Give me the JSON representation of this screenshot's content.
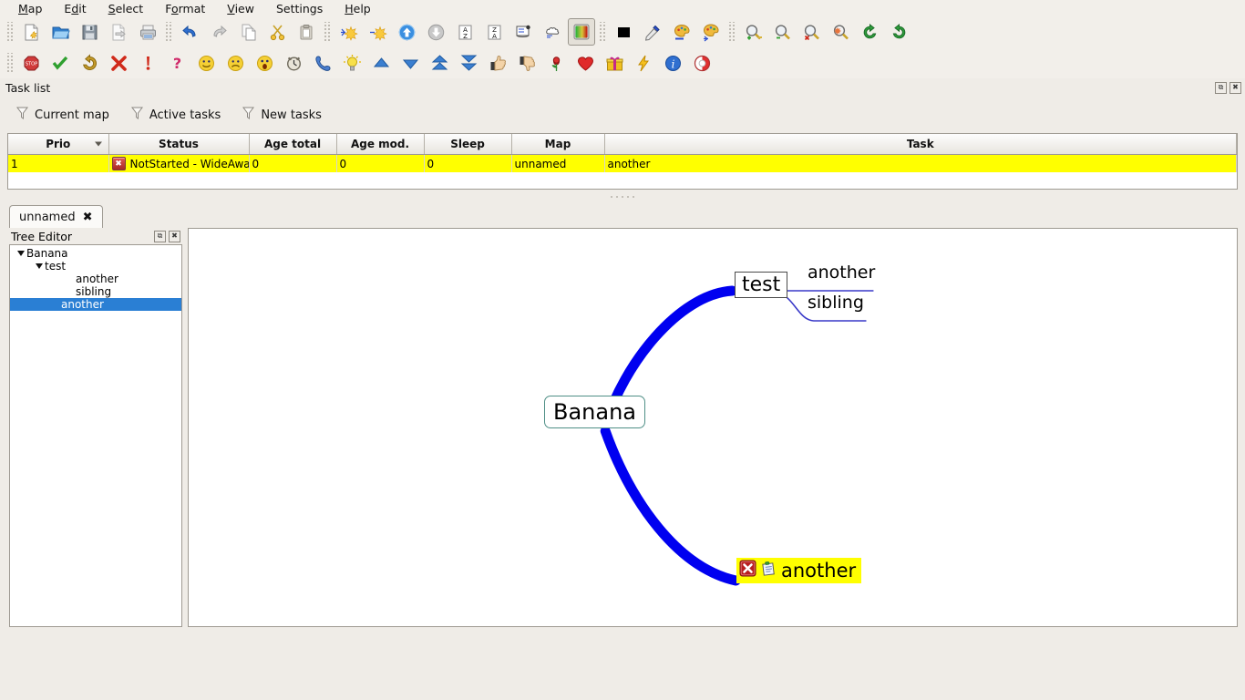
{
  "menubar": {
    "items": [
      {
        "pre": "",
        "hot": "M",
        "post": "ap"
      },
      {
        "pre": "E",
        "hot": "d",
        "post": "it"
      },
      {
        "pre": "",
        "hot": "S",
        "post": "elect"
      },
      {
        "pre": "F",
        "hot": "o",
        "post": "rmat"
      },
      {
        "pre": "",
        "hot": "V",
        "post": "iew"
      },
      {
        "pre": "",
        "hot": "S",
        "post": "ettings"
      },
      {
        "pre": "",
        "hot": "H",
        "post": "elp"
      }
    ]
  },
  "toolbar_main": {
    "groups": [
      [
        "new-file-icon",
        "open-folder-icon",
        "save-icon",
        "export-icon",
        "print-icon"
      ],
      [
        "undo-icon",
        "redo-icon",
        "copy-icon",
        "cut-icon",
        "paste-icon"
      ],
      [
        "expand-node-icon",
        "collapse-node-icon",
        "move-up-icon",
        "move-down-icon",
        "sort-az-icon",
        "sort-za-icon",
        "note-icon",
        "cloud-icon",
        "gradient-color-icon"
      ],
      [
        "black-square-icon",
        "eyedropper-icon",
        "palette-font-icon",
        "palette-node-icon"
      ],
      [
        "zoom-in-icon",
        "zoom-out-icon",
        "zoom-reset-icon",
        "zoom-fit-icon",
        "rotate-left-icon",
        "rotate-right-icon"
      ]
    ]
  },
  "toolbar_icons": {
    "icons": [
      "stop-icon",
      "check-icon",
      "redo-arrow-icon",
      "cross-icon",
      "exclamation-icon",
      "question-icon",
      "smiley-happy-icon",
      "smiley-sad-icon",
      "smiley-surprised-icon",
      "alarm-clock-icon",
      "phone-icon",
      "lightbulb-icon",
      "arrow-up-icon",
      "arrow-down-icon",
      "arrow-double-up-icon",
      "arrow-double-down-icon",
      "thumbs-up-icon",
      "thumbs-down-icon",
      "rose-icon",
      "heart-icon",
      "gift-icon",
      "lightning-icon",
      "info-icon",
      "lifebuoy-icon"
    ]
  },
  "tasklist": {
    "title": "Task list",
    "float_label": "⧉",
    "close_label": "✖",
    "filters": [
      {
        "label": "Current map",
        "icon": "funnel-icon"
      },
      {
        "label": "Active tasks",
        "icon": "funnel-icon"
      },
      {
        "label": "New tasks",
        "icon": "funnel-icon"
      }
    ],
    "columns": [
      "Prio",
      "Status",
      "Age total",
      "Age mod.",
      "Sleep",
      "Map",
      "Task"
    ],
    "rows": [
      {
        "prio": "1",
        "status": "NotStarted - WideAwa...",
        "status_icon": "red-x-icon",
        "age_total": "0",
        "age_mod": "0",
        "sleep": "0",
        "map": "unnamed",
        "task": "another"
      }
    ]
  },
  "maptabs": {
    "tabs": [
      {
        "label": "unnamed",
        "close": "✖"
      }
    ]
  },
  "tree_editor": {
    "title": "Tree Editor",
    "float_label": "⧉",
    "close_label": "✖",
    "nodes": [
      {
        "label": "Banana",
        "indent": 0,
        "twist": true,
        "selected": false
      },
      {
        "label": "test",
        "indent": 1,
        "twist": true,
        "selected": false
      },
      {
        "label": "another",
        "indent": 3,
        "twist": false,
        "selected": false
      },
      {
        "label": "sibling",
        "indent": 3,
        "twist": false,
        "selected": false
      },
      {
        "label": "another",
        "indent": 2,
        "twist": false,
        "selected": true
      }
    ]
  },
  "mindmap": {
    "root": {
      "label": "Banana"
    },
    "nodes": [
      {
        "label": "test",
        "style": "box"
      },
      {
        "label": "another",
        "style": "plain"
      },
      {
        "label": "sibling",
        "style": "plain"
      },
      {
        "label": "another",
        "style": "highlighted",
        "icons": [
          "red-x-icon",
          "note-icon"
        ]
      }
    ],
    "colors": {
      "branch": "#0000f0",
      "thin_branch": "#3838c8",
      "highlight": "#ffff00",
      "root_border": "#4f8f86"
    }
  }
}
